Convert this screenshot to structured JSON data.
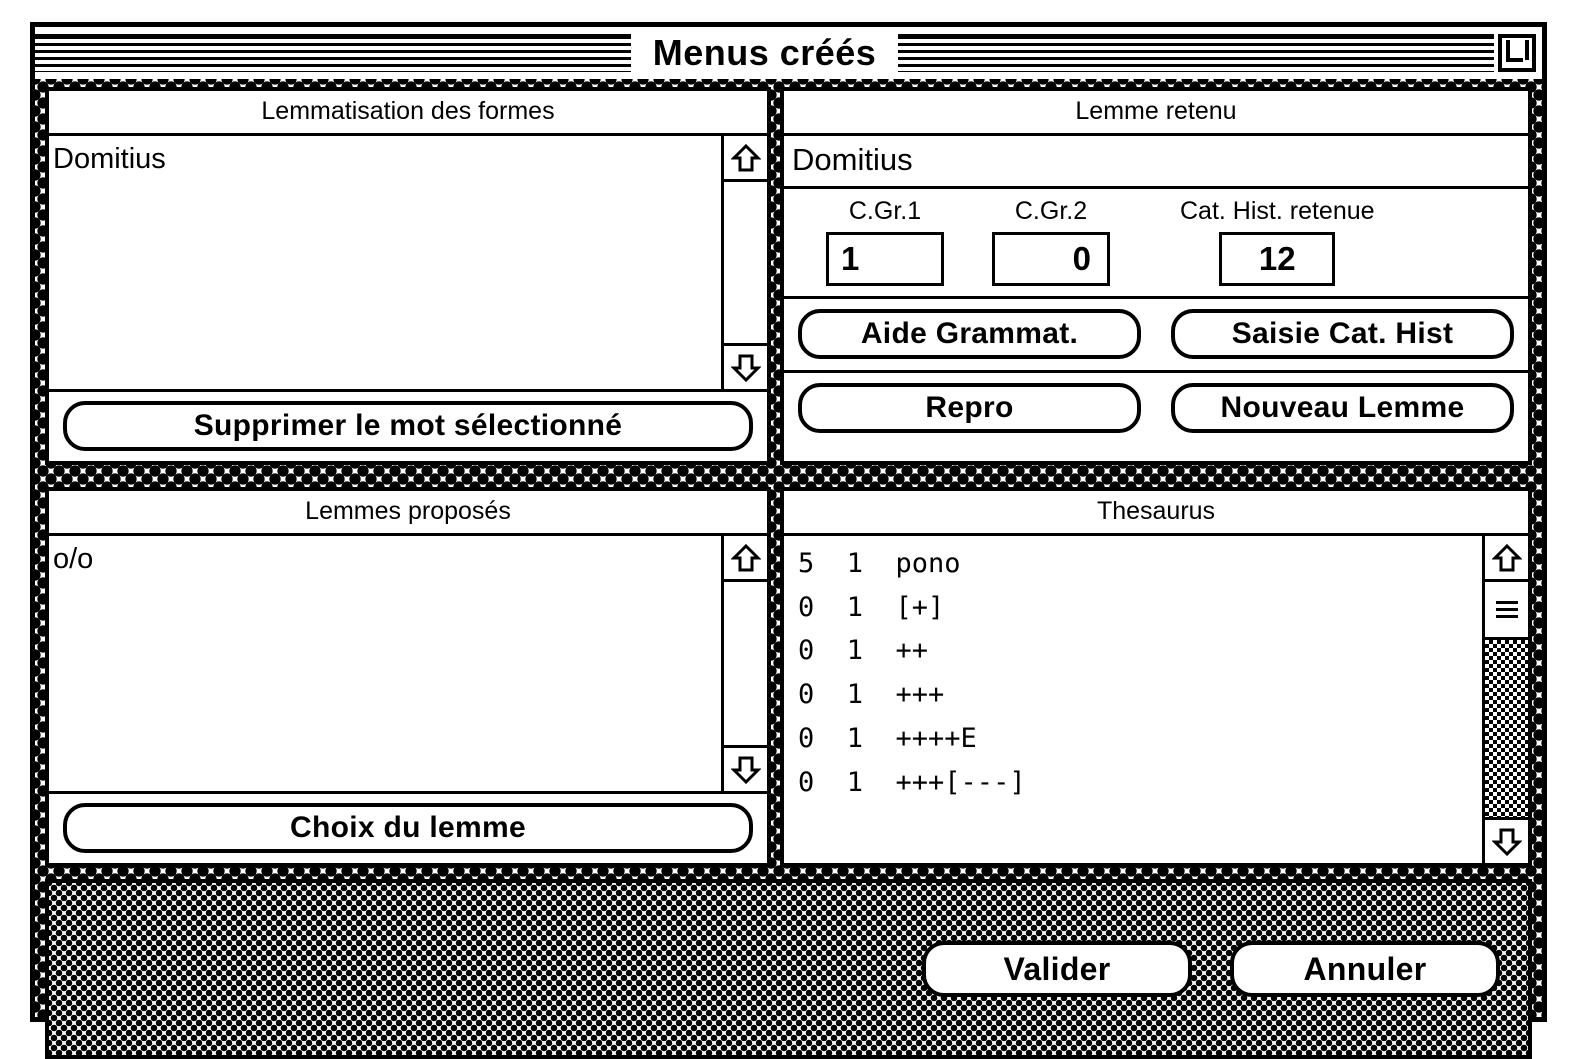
{
  "window": {
    "title": "Menus créés",
    "zoom_box_icon": "zoom-box-icon"
  },
  "left_top_panel": {
    "title": "Lemmatisation des formes",
    "items": [
      "Domitius"
    ],
    "button": "Supprimer le mot sélectionné",
    "scrollbar": {
      "up_icon": "arrow-up-icon",
      "down_icon": "arrow-down-icon",
      "has_thumb": false
    }
  },
  "right_top_panel": {
    "title": "Lemme retenu",
    "lemma_value": "Domitius",
    "fields": [
      {
        "label": "C.Gr.1",
        "value": "1"
      },
      {
        "label": "C.Gr.2",
        "value": "0"
      },
      {
        "label": "Cat. Hist. retenue",
        "value": "12"
      }
    ],
    "buttons_row1": [
      "Aide Grammat.",
      "Saisie Cat. Hist"
    ],
    "buttons_row2": [
      "Repro",
      "Nouveau Lemme"
    ]
  },
  "left_bottom_panel": {
    "title": "Lemmes proposés",
    "items": [
      "o/o"
    ],
    "button": "Choix du lemme",
    "scrollbar": {
      "up_icon": "arrow-up-icon",
      "down_icon": "arrow-down-icon",
      "has_thumb": false
    }
  },
  "right_bottom_panel": {
    "title": "Thesaurus",
    "rows": [
      "5  1  pono",
      "0  1  [+]",
      "0  1  ++",
      "0  1  +++",
      "0  1  ++++E",
      "0  1  +++[---]"
    ],
    "scrollbar": {
      "up_icon": "arrow-up-icon",
      "down_icon": "arrow-down-icon",
      "has_thumb": true
    }
  },
  "action_bar": {
    "validate": "Valider",
    "cancel": "Annuler"
  },
  "colors": {
    "ink": "#000000",
    "paper": "#ffffff"
  }
}
